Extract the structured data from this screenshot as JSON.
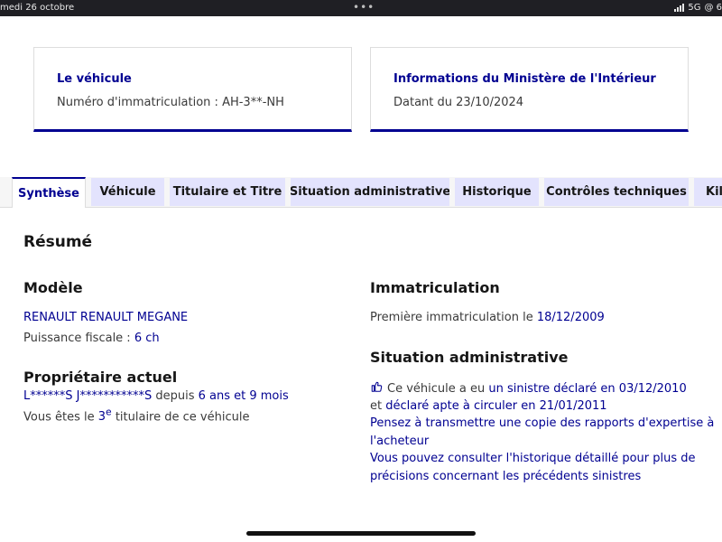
{
  "status_bar": {
    "date": "medi 26 octobre",
    "dots": "•••",
    "network": "5G",
    "extra": "@ 6"
  },
  "cards": [
    {
      "title": "Le véhicule",
      "line": "Numéro d'immatriculation : AH-3**-NH"
    },
    {
      "title": "Informations du Ministère de l'Intérieur",
      "line": "Datant du 23/10/2024"
    }
  ],
  "tabs": [
    {
      "label": "Synthèse"
    },
    {
      "label": "Véhicule"
    },
    {
      "label": "Titulaire et Titre"
    },
    {
      "label": "Situation administrative"
    },
    {
      "label": "Historique"
    },
    {
      "label": "Contrôles techniques"
    },
    {
      "label": "Kilo"
    }
  ],
  "summary": {
    "title": "Résumé",
    "model": {
      "heading": "Modèle",
      "name": "RENAULT RENAULT MEGANE",
      "power_label": "Puissance fiscale : ",
      "power_value": "6 ch"
    },
    "owner": {
      "heading": "Propriétaire actuel",
      "name": "L******S J***********S",
      "since_label": " depuis ",
      "since_value": "6 ans et 9 mois",
      "rank_prefix": "Vous êtes le ",
      "rank_number": "3",
      "rank_sup": "e",
      "rank_suffix": " titulaire de ce véhicule"
    },
    "registration": {
      "heading": "Immatriculation",
      "first_label": "Première immatriculation le ",
      "first_date": "18/12/2009"
    },
    "admin": {
      "heading": "Situation administrative",
      "icon": "thumbs-up-icon",
      "line1_prefix": "Ce véhicule a eu ",
      "line1_link": "un sinistre déclaré en 03/12/2010",
      "line2_prefix": "et ",
      "line2_link": "déclaré apte à circuler en 21/01/2011",
      "advice1_a": "Pensez à transmettre une copie des rapports d'expertise à",
      "advice1_b": "l'acheteur",
      "advice2_a": "Vous pouvez consulter l'historique détaillé pour plus de",
      "advice2_b": "précisions concernant les précédents sinistres"
    }
  },
  "colors": {
    "accent": "#000091",
    "tab_bg": "#e3e3fd",
    "text": "#3a3a3a"
  }
}
